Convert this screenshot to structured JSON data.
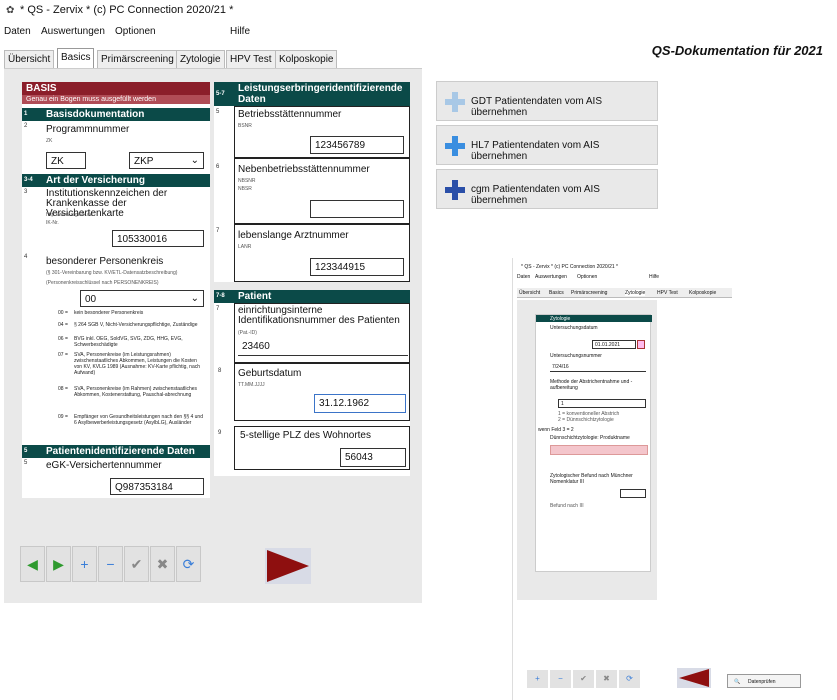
{
  "window": {
    "title": "* QS - Zervix *    (c) PC Connection 2020/21 *"
  },
  "menu": [
    "Daten",
    "Auswertungen",
    "Optionen",
    "Hilfe"
  ],
  "tabs": [
    "Übersicht",
    "Basics",
    "Primärscreening",
    "Zytologie",
    "HPV Test",
    "Kolposkopie"
  ],
  "app_title": "QS-Dokumentation für 2021",
  "basis": {
    "title": "BASIS",
    "subtitle": "Genau ein Bogen muss ausgefüllt werden",
    "sec1": {
      "num": "1",
      "title": "Basisdokumentation"
    },
    "f2": {
      "num": "2",
      "label": "Programmnummer",
      "hint": "ZK",
      "value1": "ZK",
      "value2": "ZKP"
    },
    "sec2": {
      "num": "3-4",
      "title": "Art der Versicherung"
    },
    "f3": {
      "num": "3",
      "label": "Institutionskennzeichen der Krankenkasse der Versichertenkarte",
      "hint1": "http://www.arge-ik.de",
      "hint2": "IK-Nr.",
      "value": "105330016"
    },
    "f4": {
      "num": "4",
      "label": "besonderer Personenkreis",
      "hint1": "(§ 301-Vereinbarung bzw. KV/ETL-Datensatzbeschreibung)",
      "hint2": "(Personenkreisschlüssel nach PERSONENKREIS)",
      "value": "00",
      "options": [
        {
          "code": "00 =",
          "text": "kein besonderer Personenkreis"
        },
        {
          "code": "04 =",
          "text": "§ 264 SGB V, Nicht-Versicherungspflichtige, Zuständige"
        },
        {
          "code": "06 =",
          "text": "BVG inkl. OEG, SoldVG, SVG, ZDG, HHG, EVG, Schwerbeschädigte"
        },
        {
          "code": "07 =",
          "text": "SVA, Personenkreise (im Leistungsrahmen) zwischenstaatliches Abkommen, Leistungen die Kosten von KV, KVLG 1989 (Ausnahme: KV-Karte pflichtig, nach Aufwand)"
        },
        {
          "code": "08 =",
          "text": "SVA, Personenkreise (im Rahmen) zwischenstaatliches Abkommen, Kostenerstattung, Pauschal-abrechnung"
        },
        {
          "code": "09 =",
          "text": "Empfänger von Gesundheitsleistungen nach den §§ 4 und 6 Asylbewerberleistungsgesetz (AsylbLG), Ausländer"
        }
      ]
    },
    "sec3": {
      "num": "5",
      "title": "Patientenidentifizierende Daten"
    },
    "f5": {
      "num": "5",
      "label": "eGK-Versichertennummer",
      "value": "Q987353184"
    }
  },
  "leist": {
    "sec": {
      "num": "5-7",
      "title": "Leistungserbringeridentifizierende Daten"
    },
    "f5": {
      "num": "5",
      "label": "Betriebsstättennummer",
      "hint": "BSNR",
      "value": "123456789"
    },
    "f6": {
      "num": "6",
      "label": "Nebenbetriebsstättennummer",
      "hint1": "NBSNR",
      "hint2": "NBSR",
      "value": ""
    },
    "f7": {
      "num": "7",
      "label": "lebenslange Arztnummer",
      "hint": "LANR",
      "value": "123344915"
    }
  },
  "patient": {
    "sec": {
      "num": "7-8",
      "title": "Patient"
    },
    "f7": {
      "num": "7",
      "label": "einrichtungsinterne Identifikationsnummer des Patienten",
      "hint": "(Pat.-ID)",
      "value": "23460"
    },
    "f8": {
      "num": "8",
      "label": "Geburtsdatum",
      "hint": "TT.MM.JJJJ",
      "value": "31.12.1962"
    },
    "f9": {
      "num": "9",
      "label": "5-stellige PLZ des Wohnortes",
      "value": "56043"
    }
  },
  "buttons": {
    "gdt": "GDT Patientendaten vom AIS übernehmen",
    "hl7": "HL7 Patientendaten vom AIS übernehmen",
    "cgm": "cgm Patientendaten vom AIS übernehmen"
  },
  "nav": [
    "◀",
    "▶",
    "+",
    "−",
    "✔",
    "✖",
    "⟳"
  ],
  "small": {
    "title": "* QS - Zervix *    (c) PC Connection 2020/21 *",
    "menu": [
      "Daten",
      "Auswertungen",
      "Optionen",
      "Hilfe"
    ],
    "tabs": [
      "Übersicht",
      "Basics",
      "Primärscreening",
      "Zytologie",
      "HPV Test",
      "Kolposkopie"
    ],
    "sec": "Zytologie",
    "f1": "Untersuchungsdatum",
    "f1v": "01.01.2021",
    "f2": "Untersuchungsnummer",
    "f2v": "7/24/16",
    "f3": "Methode der Abstrichentnahme und -aufbereitung",
    "f3v": "1",
    "f3o1": "1 = konventioneller Abstrich",
    "f3o2": "2 = Dünnschichtzytologie",
    "f4hdr": "wenn Feld 3 = 2",
    "f4": "Dünnschichtzytologie: Produktname",
    "f5": "Zytologischer Befund nach Münchner Nomenklatur III",
    "f5h": "Befund nach III",
    "save": "Datenprüfen"
  },
  "colors": {
    "red_header": "#8b1e2a",
    "green_header": "#0b4a48",
    "arrow": "#8e0f0f"
  }
}
